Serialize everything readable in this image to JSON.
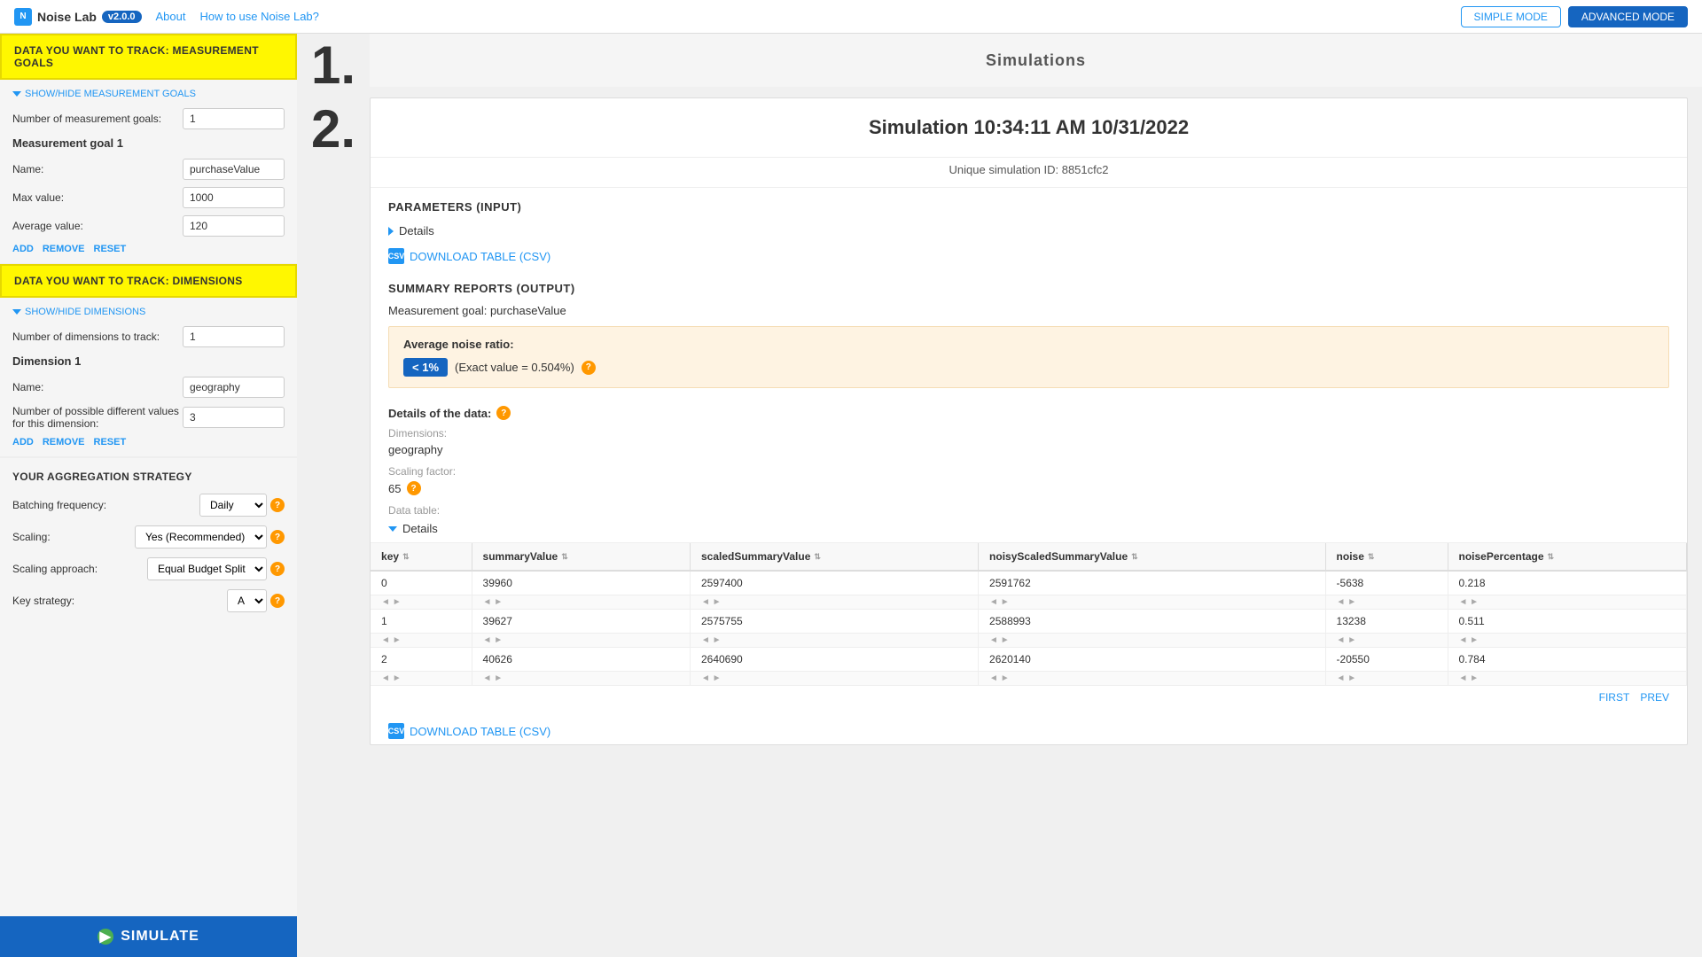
{
  "header": {
    "logo_text": "Noise Lab",
    "version": "v2.0.0",
    "nav_links": [
      "About",
      "How to use Noise Lab?"
    ],
    "simple_mode_label": "SIMPLE MODE",
    "advanced_mode_label": "ADVANCED MODE"
  },
  "sidebar": {
    "section1_title": "DATA YOU WANT TO TRACK: MEASUREMENT GOALS",
    "show_hide_goals": "SHOW/HIDE MEASUREMENT GOALS",
    "num_goals_label": "Number of measurement goals:",
    "num_goals_value": "1",
    "goal1_title": "Measurement goal 1",
    "goal_name_label": "Name:",
    "goal_name_value": "purchaseValue",
    "goal_max_label": "Max value:",
    "goal_max_value": "1000",
    "goal_avg_label": "Average value:",
    "goal_avg_value": "120",
    "goal_actions": [
      "ADD",
      "REMOVE",
      "RESET"
    ],
    "section2_title": "DATA YOU WANT TO TRACK: DIMENSIONS",
    "show_hide_dims": "SHOW/HIDE DIMENSIONS",
    "num_dims_label": "Number of dimensions to track:",
    "num_dims_value": "1",
    "dim1_title": "Dimension 1",
    "dim_name_label": "Name:",
    "dim_name_value": "geography",
    "dim_possible_label": "Number of possible different values for this dimension:",
    "dim_possible_value": "3",
    "dim_actions": [
      "ADD",
      "REMOVE",
      "RESET"
    ],
    "agg_title": "YOUR AGGREGATION STRATEGY",
    "batching_label": "Batching frequency:",
    "batching_value": "Daily",
    "scaling_label": "Scaling:",
    "scaling_value": "Yes (Recommended)",
    "scaling_approach_label": "Scaling approach:",
    "scaling_approach_value": "Equal Budget Split",
    "key_strategy_label": "Key strategy:",
    "key_strategy_value": "A",
    "simulate_btn": "SIMULATE"
  },
  "steps": {
    "step1": "1.",
    "step2": "2."
  },
  "main": {
    "simulations_label": "Simulations",
    "sim_title": "Simulation 10:34:11 AM 10/31/2022",
    "sim_id": "Unique simulation ID: 8851cfc2",
    "params_header": "PARAMETERS (INPUT)",
    "details_label": "Details",
    "download_csv_label": "DOWNLOAD TABLE (CSV)",
    "summary_header": "SUMMARY REPORTS (OUTPUT)",
    "measurement_goal_label": "Measurement goal: purchaseValue",
    "avg_noise_ratio_label": "Average noise ratio:",
    "noise_badge": "< 1%",
    "noise_exact": "(Exact value = 0.504%)",
    "details_of_data_label": "Details of the data:",
    "dimensions_label": "Dimensions:",
    "dimensions_value": "geography",
    "scaling_factor_label": "Scaling factor:",
    "scaling_factor_value": "65",
    "data_table_label": "Data table:",
    "data_table_toggle": "Details",
    "table_columns": [
      "key",
      "summaryValue",
      "scaledSummaryValue",
      "noisyScaledSummaryValue",
      "noise",
      "noisePercentage"
    ],
    "table_rows": [
      {
        "key": "0",
        "summaryValue": "39960",
        "scaledSummaryValue": "2597400",
        "noisyScaledSummaryValue": "2591762",
        "noise": "-5638",
        "noisePercentage": "0.218"
      },
      {
        "key": "1",
        "summaryValue": "39627",
        "scaledSummaryValue": "2575755",
        "noisyScaledSummaryValue": "2588993",
        "noise": "13238",
        "noisePercentage": "0.511"
      },
      {
        "key": "2",
        "summaryValue": "40626",
        "scaledSummaryValue": "2640690",
        "noisyScaledSummaryValue": "2620140",
        "noise": "-20550",
        "noisePercentage": "0.784"
      }
    ],
    "nav_first": "FIRST",
    "nav_prev": "PREV",
    "download_csv2_label": "DOWNLOAD TABLE (CSV)"
  }
}
